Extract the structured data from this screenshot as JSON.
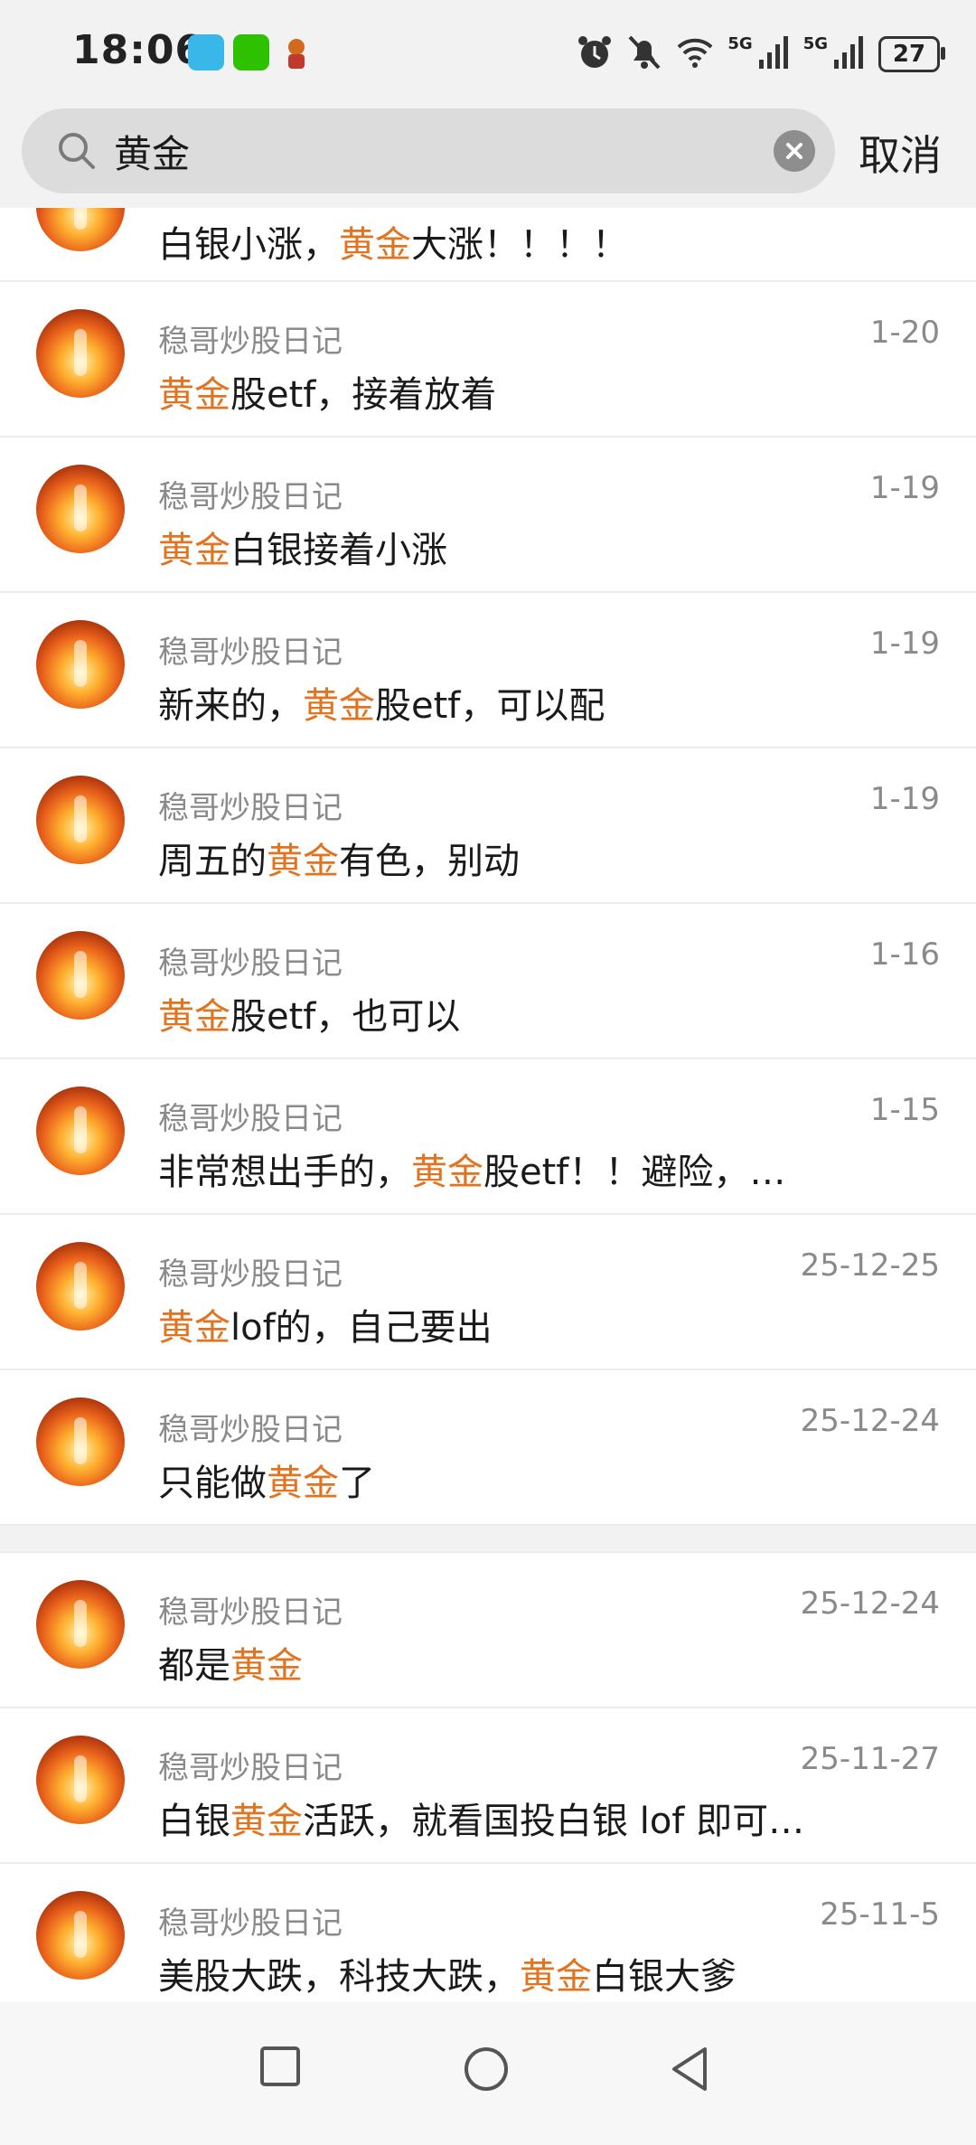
{
  "status_bar": {
    "time": "18:06",
    "app_icons": [
      "book-app-icon",
      "wechat-icon",
      "fortune-app-icon"
    ],
    "network_1": "5G",
    "network_2": "5G",
    "battery": "27"
  },
  "search": {
    "query": "黄金",
    "cancel_label": "取消"
  },
  "highlight_color": "#e2731f",
  "results": [
    {
      "partial": true,
      "author": "",
      "date": "",
      "parts": [
        {
          "t": "白银小涨，",
          "h": false
        },
        {
          "t": "黄金",
          "h": true
        },
        {
          "t": "大涨！！！！",
          "h": false
        }
      ]
    },
    {
      "author": "稳哥炒股日记",
      "date": "1-20",
      "parts": [
        {
          "t": "黄金",
          "h": true
        },
        {
          "t": "股etf，接着放着",
          "h": false
        }
      ]
    },
    {
      "author": "稳哥炒股日记",
      "date": "1-19",
      "parts": [
        {
          "t": "黄金",
          "h": true
        },
        {
          "t": "白银接着小涨",
          "h": false
        }
      ]
    },
    {
      "author": "稳哥炒股日记",
      "date": "1-19",
      "parts": [
        {
          "t": "新来的，",
          "h": false
        },
        {
          "t": "黄金",
          "h": true
        },
        {
          "t": "股etf，可以配",
          "h": false
        }
      ]
    },
    {
      "author": "稳哥炒股日记",
      "date": "1-19",
      "parts": [
        {
          "t": "周五的",
          "h": false
        },
        {
          "t": "黄金",
          "h": true
        },
        {
          "t": "有色，别动",
          "h": false
        }
      ]
    },
    {
      "author": "稳哥炒股日记",
      "date": "1-16",
      "parts": [
        {
          "t": "黄金",
          "h": true
        },
        {
          "t": "股etf，也可以",
          "h": false
        }
      ]
    },
    {
      "author": "稳哥炒股日记",
      "date": "1-15",
      "parts": [
        {
          "t": "非常想出手的，",
          "h": false
        },
        {
          "t": "黄金",
          "h": true
        },
        {
          "t": "股etf！！避险，…",
          "h": false
        }
      ]
    },
    {
      "author": "稳哥炒股日记",
      "date": "25-12-25",
      "parts": [
        {
          "t": "黄金",
          "h": true
        },
        {
          "t": "lof的，自己要出",
          "h": false
        }
      ]
    },
    {
      "author": "稳哥炒股日记",
      "date": "25-12-24",
      "parts": [
        {
          "t": "只能做",
          "h": false
        },
        {
          "t": "黄金",
          "h": true
        },
        {
          "t": "了",
          "h": false
        }
      ]
    },
    {
      "gap": true
    },
    {
      "author": "稳哥炒股日记",
      "date": "25-12-24",
      "parts": [
        {
          "t": "都是",
          "h": false
        },
        {
          "t": "黄金",
          "h": true
        }
      ]
    },
    {
      "author": "稳哥炒股日记",
      "date": "25-11-27",
      "parts": [
        {
          "t": "白银",
          "h": false
        },
        {
          "t": "黄金",
          "h": true
        },
        {
          "t": "活跃，就看国投白银 lof 即可…",
          "h": false
        }
      ]
    },
    {
      "author": "稳哥炒股日记",
      "date": "25-11-5",
      "parts": [
        {
          "t": "美股大跌，科技大跌，",
          "h": false
        },
        {
          "t": "黄金",
          "h": true
        },
        {
          "t": "白银大爹",
          "h": false
        }
      ]
    }
  ],
  "nav": [
    "recents-button",
    "home-button",
    "back-button"
  ]
}
